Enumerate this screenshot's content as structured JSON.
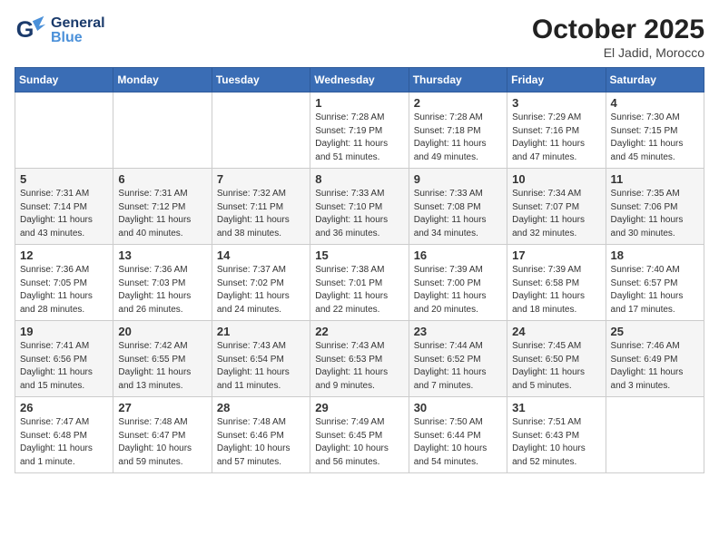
{
  "header": {
    "logo_general": "General",
    "logo_blue": "Blue",
    "month_title": "October 2025",
    "subtitle": "El Jadid, Morocco"
  },
  "calendar": {
    "days_of_week": [
      "Sunday",
      "Monday",
      "Tuesday",
      "Wednesday",
      "Thursday",
      "Friday",
      "Saturday"
    ],
    "weeks": [
      [
        {
          "num": "",
          "info": ""
        },
        {
          "num": "",
          "info": ""
        },
        {
          "num": "",
          "info": ""
        },
        {
          "num": "1",
          "info": "Sunrise: 7:28 AM\nSunset: 7:19 PM\nDaylight: 11 hours\nand 51 minutes."
        },
        {
          "num": "2",
          "info": "Sunrise: 7:28 AM\nSunset: 7:18 PM\nDaylight: 11 hours\nand 49 minutes."
        },
        {
          "num": "3",
          "info": "Sunrise: 7:29 AM\nSunset: 7:16 PM\nDaylight: 11 hours\nand 47 minutes."
        },
        {
          "num": "4",
          "info": "Sunrise: 7:30 AM\nSunset: 7:15 PM\nDaylight: 11 hours\nand 45 minutes."
        }
      ],
      [
        {
          "num": "5",
          "info": "Sunrise: 7:31 AM\nSunset: 7:14 PM\nDaylight: 11 hours\nand 43 minutes."
        },
        {
          "num": "6",
          "info": "Sunrise: 7:31 AM\nSunset: 7:12 PM\nDaylight: 11 hours\nand 40 minutes."
        },
        {
          "num": "7",
          "info": "Sunrise: 7:32 AM\nSunset: 7:11 PM\nDaylight: 11 hours\nand 38 minutes."
        },
        {
          "num": "8",
          "info": "Sunrise: 7:33 AM\nSunset: 7:10 PM\nDaylight: 11 hours\nand 36 minutes."
        },
        {
          "num": "9",
          "info": "Sunrise: 7:33 AM\nSunset: 7:08 PM\nDaylight: 11 hours\nand 34 minutes."
        },
        {
          "num": "10",
          "info": "Sunrise: 7:34 AM\nSunset: 7:07 PM\nDaylight: 11 hours\nand 32 minutes."
        },
        {
          "num": "11",
          "info": "Sunrise: 7:35 AM\nSunset: 7:06 PM\nDaylight: 11 hours\nand 30 minutes."
        }
      ],
      [
        {
          "num": "12",
          "info": "Sunrise: 7:36 AM\nSunset: 7:05 PM\nDaylight: 11 hours\nand 28 minutes."
        },
        {
          "num": "13",
          "info": "Sunrise: 7:36 AM\nSunset: 7:03 PM\nDaylight: 11 hours\nand 26 minutes."
        },
        {
          "num": "14",
          "info": "Sunrise: 7:37 AM\nSunset: 7:02 PM\nDaylight: 11 hours\nand 24 minutes."
        },
        {
          "num": "15",
          "info": "Sunrise: 7:38 AM\nSunset: 7:01 PM\nDaylight: 11 hours\nand 22 minutes."
        },
        {
          "num": "16",
          "info": "Sunrise: 7:39 AM\nSunset: 7:00 PM\nDaylight: 11 hours\nand 20 minutes."
        },
        {
          "num": "17",
          "info": "Sunrise: 7:39 AM\nSunset: 6:58 PM\nDaylight: 11 hours\nand 18 minutes."
        },
        {
          "num": "18",
          "info": "Sunrise: 7:40 AM\nSunset: 6:57 PM\nDaylight: 11 hours\nand 17 minutes."
        }
      ],
      [
        {
          "num": "19",
          "info": "Sunrise: 7:41 AM\nSunset: 6:56 PM\nDaylight: 11 hours\nand 15 minutes."
        },
        {
          "num": "20",
          "info": "Sunrise: 7:42 AM\nSunset: 6:55 PM\nDaylight: 11 hours\nand 13 minutes."
        },
        {
          "num": "21",
          "info": "Sunrise: 7:43 AM\nSunset: 6:54 PM\nDaylight: 11 hours\nand 11 minutes."
        },
        {
          "num": "22",
          "info": "Sunrise: 7:43 AM\nSunset: 6:53 PM\nDaylight: 11 hours\nand 9 minutes."
        },
        {
          "num": "23",
          "info": "Sunrise: 7:44 AM\nSunset: 6:52 PM\nDaylight: 11 hours\nand 7 minutes."
        },
        {
          "num": "24",
          "info": "Sunrise: 7:45 AM\nSunset: 6:50 PM\nDaylight: 11 hours\nand 5 minutes."
        },
        {
          "num": "25",
          "info": "Sunrise: 7:46 AM\nSunset: 6:49 PM\nDaylight: 11 hours\nand 3 minutes."
        }
      ],
      [
        {
          "num": "26",
          "info": "Sunrise: 7:47 AM\nSunset: 6:48 PM\nDaylight: 11 hours\nand 1 minute."
        },
        {
          "num": "27",
          "info": "Sunrise: 7:48 AM\nSunset: 6:47 PM\nDaylight: 10 hours\nand 59 minutes."
        },
        {
          "num": "28",
          "info": "Sunrise: 7:48 AM\nSunset: 6:46 PM\nDaylight: 10 hours\nand 57 minutes."
        },
        {
          "num": "29",
          "info": "Sunrise: 7:49 AM\nSunset: 6:45 PM\nDaylight: 10 hours\nand 56 minutes."
        },
        {
          "num": "30",
          "info": "Sunrise: 7:50 AM\nSunset: 6:44 PM\nDaylight: 10 hours\nand 54 minutes."
        },
        {
          "num": "31",
          "info": "Sunrise: 7:51 AM\nSunset: 6:43 PM\nDaylight: 10 hours\nand 52 minutes."
        },
        {
          "num": "",
          "info": ""
        }
      ]
    ]
  }
}
